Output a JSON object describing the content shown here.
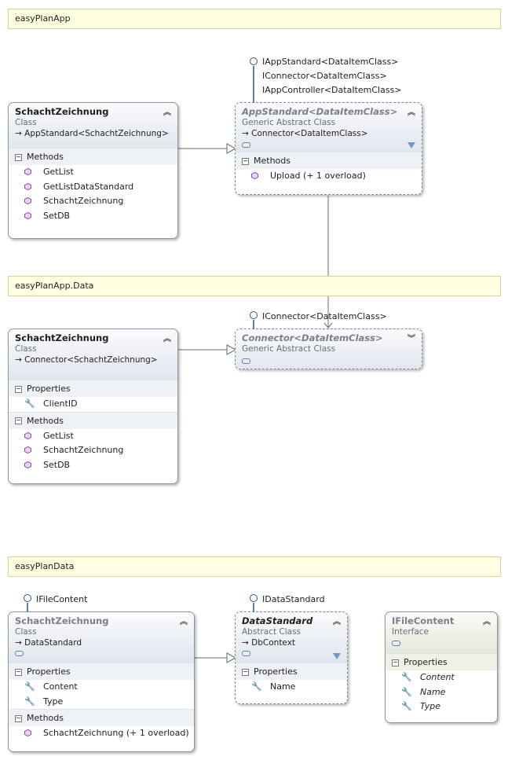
{
  "namespaces": {
    "app": "easyPlanApp",
    "app_data": "easyPlanApp.Data",
    "data": "easyPlanData"
  },
  "box1": {
    "title": "SchachtZeichnung",
    "stereotype": "Class",
    "inherits": "AppStandard<SchachtZeichnung>",
    "section": "Methods",
    "members": [
      "GetList",
      "GetListDataStandard",
      "SchachtZeichnung",
      "SetDB"
    ]
  },
  "box2": {
    "title": "AppStandard<DataItemClass>",
    "stereotype": "Generic Abstract Class",
    "inherits": "Connector<DataItemClass>",
    "interfaces": [
      "IAppStandard<DataItemClass>",
      "IConnector<DataItemClass>",
      "IAppController<DataItemClass>"
    ],
    "section": "Methods",
    "members": [
      "Upload (+ 1 overload)"
    ]
  },
  "box3": {
    "title": "SchachtZeichnung",
    "stereotype": "Class",
    "inherits": "Connector<SchachtZeichnung>",
    "section_props": "Properties",
    "props": [
      "ClientID"
    ],
    "section_methods": "Methods",
    "methods": [
      "GetList",
      "SchachtZeichnung",
      "SetDB"
    ]
  },
  "box4": {
    "title": "Connector<DataItemClass>",
    "stereotype": "Generic Abstract Class",
    "interface": "IConnector<DataItemClass>"
  },
  "box5": {
    "title": "SchachtZeichnung",
    "stereotype": "Class",
    "inherits": "DataStandard",
    "interface": "IFileContent",
    "section_props": "Properties",
    "props": [
      "Content",
      "Type"
    ],
    "section_methods": "Methods",
    "methods": [
      "SchachtZeichnung (+ 1 overload)"
    ]
  },
  "box6": {
    "title": "DataStandard",
    "stereotype": "Abstract Class",
    "inherits": "DbContext",
    "interface": "IDataStandard",
    "section_props": "Properties",
    "props": [
      "Name"
    ]
  },
  "box7": {
    "title": "IFileContent",
    "stereotype": "Interface",
    "section_props": "Properties",
    "props": [
      "Content",
      "Name",
      "Type"
    ]
  },
  "colors": {
    "namespace_bg": "#ffffe1",
    "header_gradient_top": "#fafbfd",
    "header_gradient_bottom": "#e1e6ee",
    "method_icon": "#8a3fb0",
    "interface_circle": "#2c4f9a"
  },
  "icons": {
    "method": "method-cube-icon",
    "property": "wrench-icon",
    "collapse": "double-chevron-up-icon",
    "expand": "double-chevron-down-icon",
    "filter": "filter-icon",
    "inheritance": "inheritance-arrow-icon",
    "lollipop": "interface-lollipop-icon"
  }
}
